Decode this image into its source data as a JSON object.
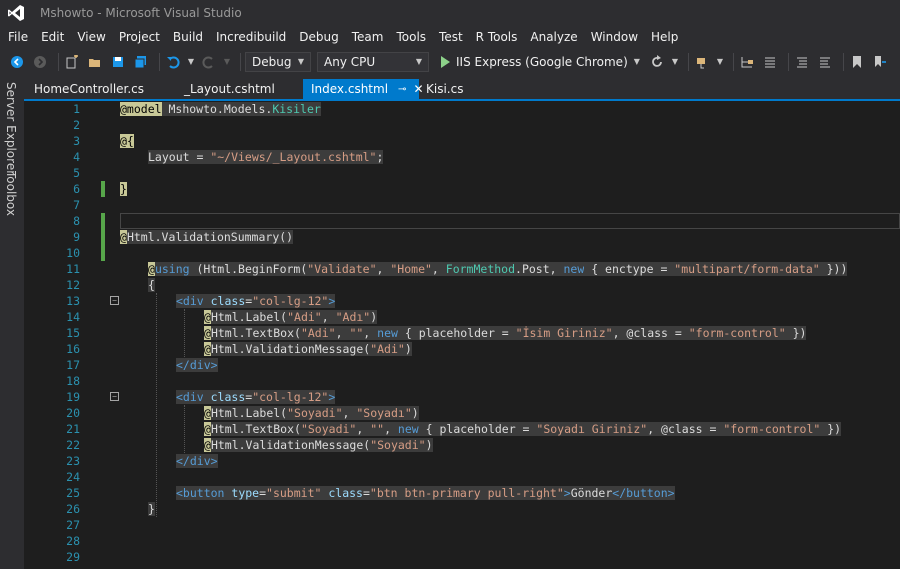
{
  "window": {
    "title": "Mshowto - Microsoft Visual Studio"
  },
  "menu": [
    "File",
    "Edit",
    "View",
    "Project",
    "Build",
    "Incredibuild",
    "Debug",
    "Team",
    "Tools",
    "Test",
    "R Tools",
    "Analyze",
    "Window",
    "Help"
  ],
  "toolbar": {
    "configuration": "Debug",
    "platform": "Any CPU",
    "run_target": "IIS Express (Google Chrome)"
  },
  "left_rail": [
    "Server Explorer",
    "Toolbox"
  ],
  "tabs": [
    {
      "label": "HomeController.cs"
    },
    {
      "label": "_Layout.cshtml"
    },
    {
      "label": "Index.cshtml",
      "active": true
    },
    {
      "label": "Kisi.cs"
    }
  ],
  "line_numbers": [
    "1",
    "2",
    "3",
    "4",
    "5",
    "6",
    "7",
    "8",
    "9",
    "10",
    "11",
    "12",
    "13",
    "14",
    "15",
    "16",
    "17",
    "18",
    "19",
    "20",
    "21",
    "22",
    "23",
    "24",
    "25",
    "26",
    "27",
    "28",
    "29"
  ],
  "code": {
    "l1_kw": "@model",
    "l1_ns": " Mshowto.Models.",
    "l1_type": "Kisiler",
    "l3": "@{",
    "l4_a": "Layout = ",
    "l4_b": "\"~/Views/_Layout.cshtml\"",
    "l4_c": ";",
    "l6": "}",
    "l9_at": "@",
    "l9_rest": "Html.ValidationSummary()",
    "l11_at": "@",
    "l11_kw": "using",
    "l11_a": " (Html.BeginForm(",
    "l11_s1": "\"Validate\"",
    "l11_c1": ", ",
    "l11_s2": "\"Home\"",
    "l11_c2": ", ",
    "l11_t": "FormMethod",
    "l11_b": ".Post, ",
    "l11_new": "new",
    "l11_c": " { enctype = ",
    "l11_s3": "\"multipart/form-data\"",
    "l11_d": " }))",
    "l12": "{",
    "div_open": "<div",
    "class_attr": " class",
    "eq": "=",
    "col_val": "\"col-lg-12\"",
    "gt": ">",
    "div_close": "</div>",
    "at": "@",
    "label_fn": "Html.Label(",
    "textbox_fn": "Html.TextBox(",
    "valmsg_fn": "Html.ValidationMessage(",
    "comma": ", ",
    "close_paren": ")",
    "adi": "\"Adi\"",
    "adi_label": "\"Adı\"",
    "empty": "\"\"",
    "new_kw": "new",
    "ph_a": " { placeholder = ",
    "adi_ph": "\"İsim Giriniz\"",
    "cls_a": ", @class = ",
    "form_control": "\"form-control\"",
    "ph_end": " })",
    "soyadi": "\"Soyadi\"",
    "soyadi_label": "\"Soyadı\"",
    "soyadi_ph": "\"Soyadı Giriniz\"",
    "btn_open": "<button",
    "type_attr": " type",
    "submit_val": "\"submit\"",
    "btn_class_val": "\"btn btn-primary pull-right\"",
    "btn_text": "Gönder",
    "btn_close": "</button>",
    "l26": "}"
  }
}
